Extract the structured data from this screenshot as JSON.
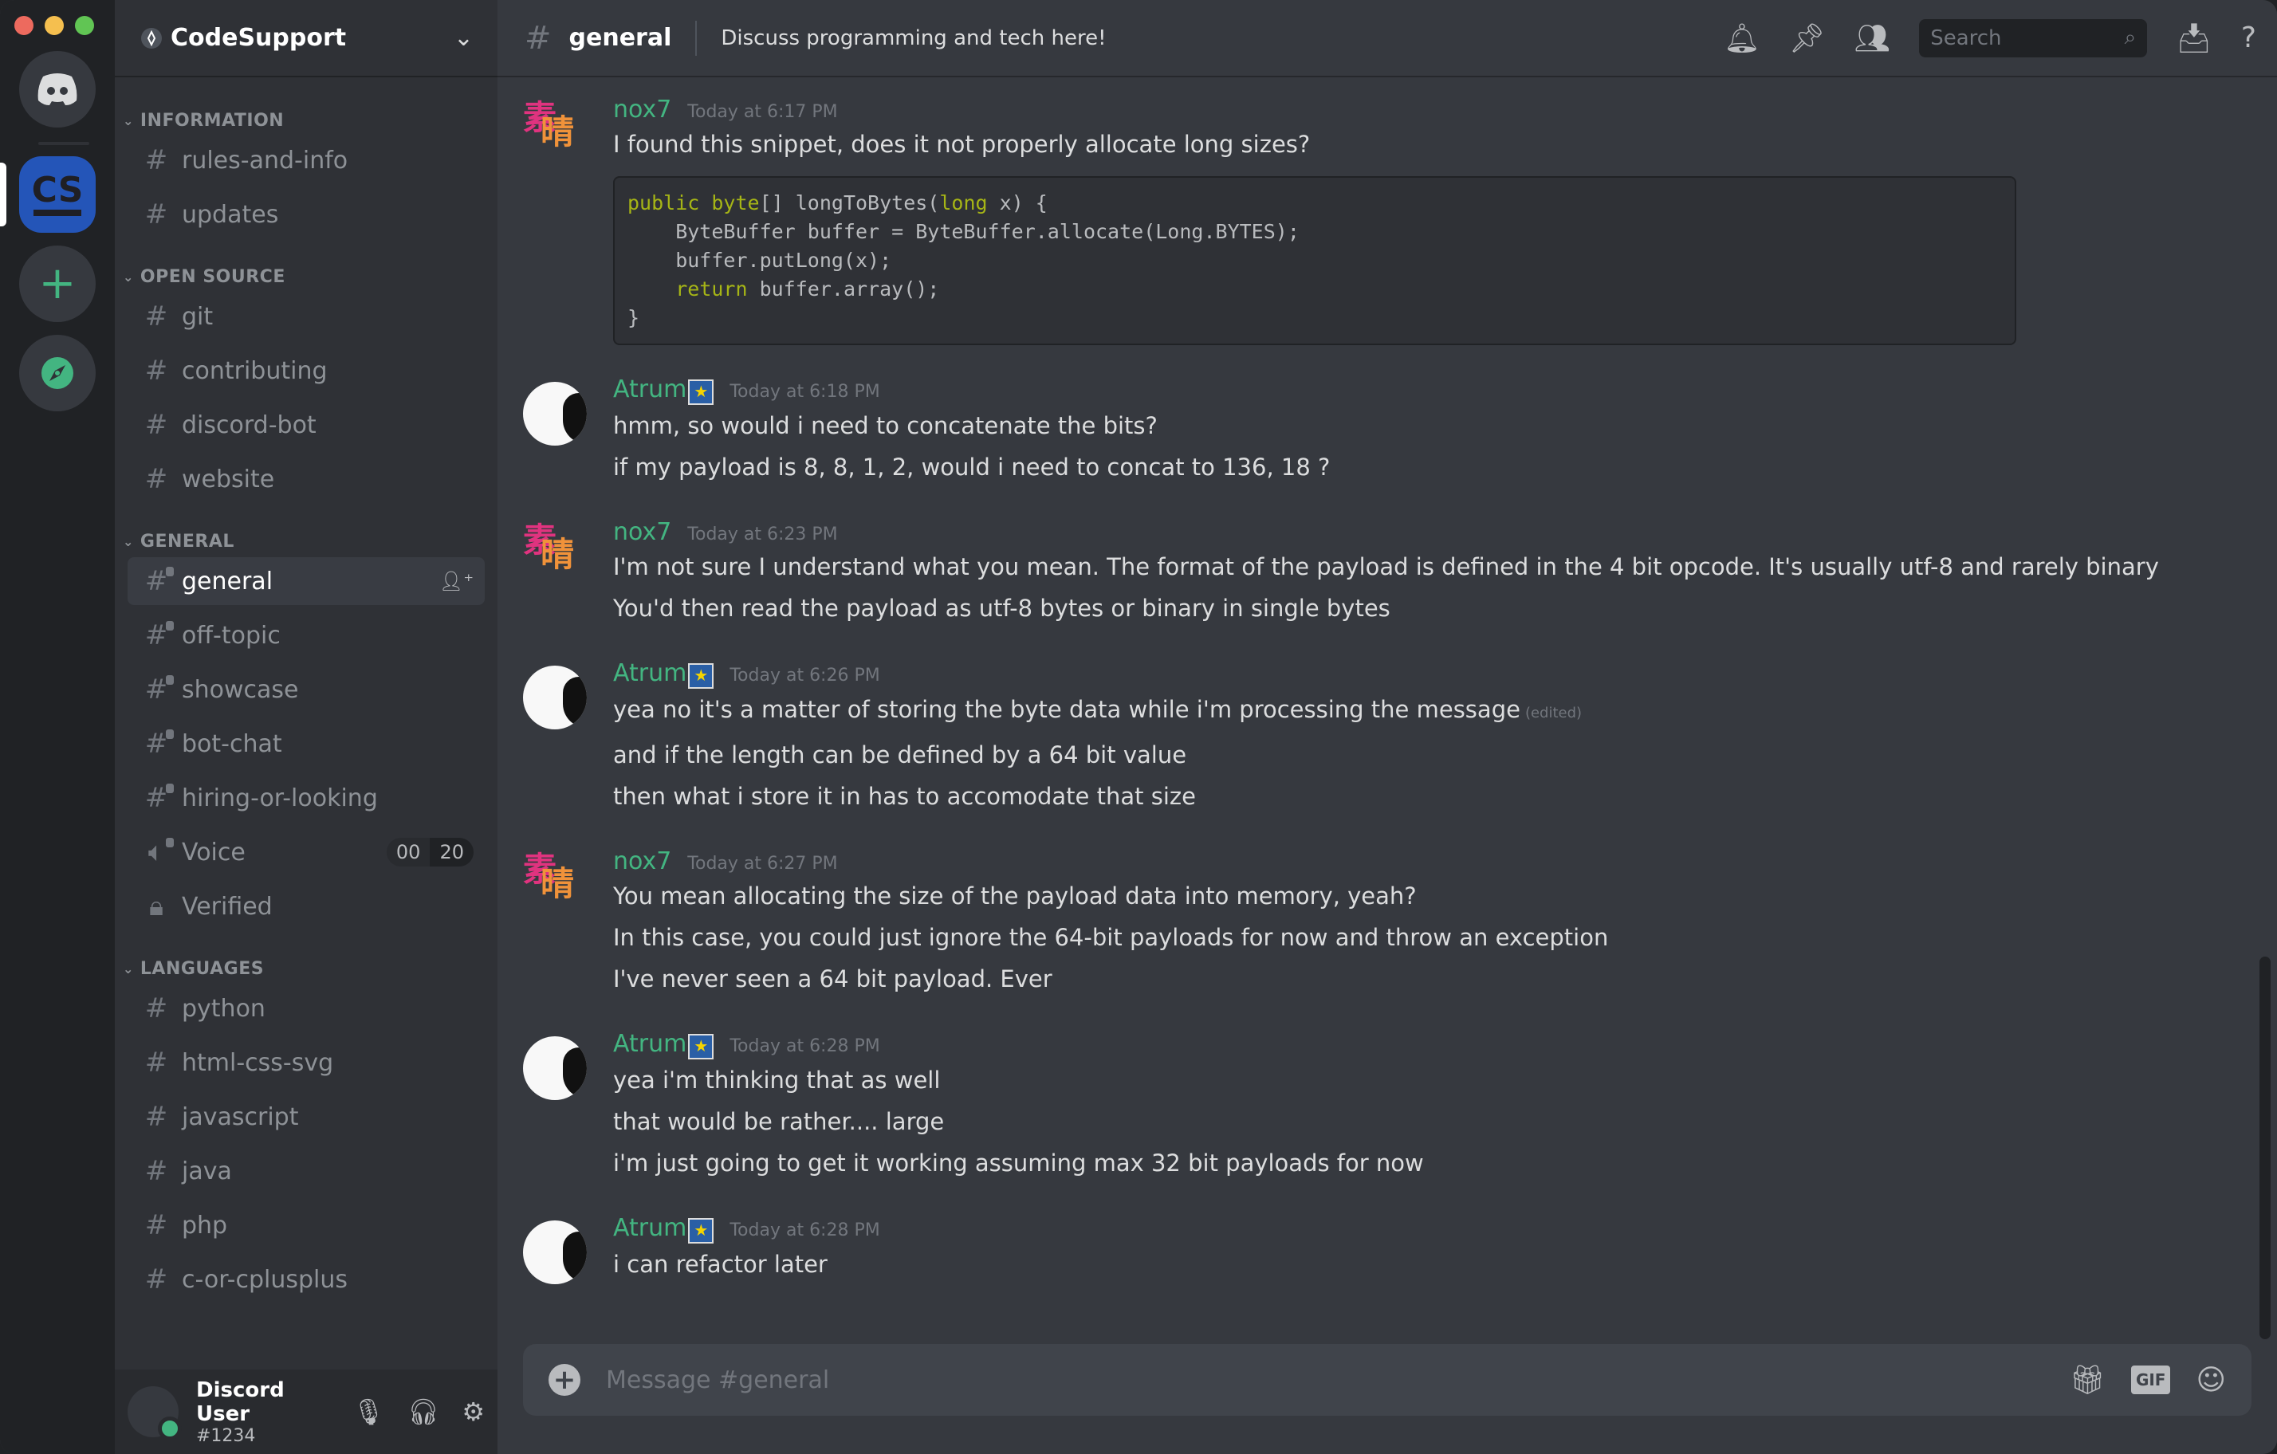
{
  "window": {
    "traffic_lights": [
      "#ed6a5e",
      "#f5bf4f",
      "#61c554"
    ]
  },
  "server_rail": {
    "servers": [
      {
        "name": "Discord Home",
        "icon": "discord-logo-icon"
      },
      {
        "name": "CodeSupport",
        "icon_text": "CS",
        "active": true
      },
      {
        "name": "Add a Server",
        "icon": "plus-icon"
      },
      {
        "name": "Explore Public Servers",
        "icon": "compass-icon"
      }
    ]
  },
  "sidebar": {
    "server_name": "CodeSupport",
    "categories": [
      {
        "name": "INFORMATION",
        "channels": [
          {
            "name": "rules-and-info",
            "type": "text"
          },
          {
            "name": "updates",
            "type": "text"
          }
        ]
      },
      {
        "name": "OPEN SOURCE",
        "channels": [
          {
            "name": "git",
            "type": "text"
          },
          {
            "name": "contributing",
            "type": "text"
          },
          {
            "name": "discord-bot",
            "type": "text"
          },
          {
            "name": "website",
            "type": "text"
          }
        ]
      },
      {
        "name": "GENERAL",
        "channels": [
          {
            "name": "general",
            "type": "text-locked",
            "active": true
          },
          {
            "name": "off-topic",
            "type": "text-locked"
          },
          {
            "name": "showcase",
            "type": "text-locked"
          },
          {
            "name": "bot-chat",
            "type": "text-locked"
          },
          {
            "name": "hiring-or-looking",
            "type": "text-locked"
          },
          {
            "name": "Voice",
            "type": "voice-locked",
            "users": "00",
            "limit": "20"
          },
          {
            "name": "Verified",
            "type": "locked"
          }
        ]
      },
      {
        "name": "LANGUAGES",
        "channels": [
          {
            "name": "python",
            "type": "text"
          },
          {
            "name": "html-css-svg",
            "type": "text"
          },
          {
            "name": "javascript",
            "type": "text"
          },
          {
            "name": "java",
            "type": "text"
          },
          {
            "name": "php",
            "type": "text"
          },
          {
            "name": "c-or-cplusplus",
            "type": "text"
          }
        ]
      }
    ],
    "user": {
      "name": "Discord User",
      "tag": "#1234",
      "status": "online"
    }
  },
  "header": {
    "channel": "general",
    "topic": "Discuss programming and tech here!",
    "search_placeholder": "Search"
  },
  "messages": [
    {
      "author": "nox7",
      "avatar": "nox7",
      "time": "Today at 6:17 PM",
      "lines": [
        "I found this snippet, does it not properly allocate long sizes?"
      ],
      "code": [
        [
          [
            "kw",
            "public"
          ],
          [
            "t",
            " "
          ],
          [
            "kw",
            "byte"
          ],
          [
            "t",
            "[] longToBytes("
          ],
          [
            "kw",
            "long"
          ],
          [
            "t",
            " x) {"
          ]
        ],
        [
          [
            "t",
            "    ByteBuffer buffer = ByteBuffer.allocate(Long.BYTES);"
          ]
        ],
        [
          [
            "t",
            "    buffer.putLong(x);"
          ]
        ],
        [
          [
            "t",
            "    "
          ],
          [
            "kw",
            "return"
          ],
          [
            "t",
            " buffer.array();"
          ]
        ],
        [
          [
            "t",
            "}"
          ]
        ]
      ]
    },
    {
      "author": "Atrum",
      "avatar": "atrum",
      "badge": true,
      "time": "Today at 6:18 PM",
      "lines": [
        "hmm, so would i need to concatenate the bits?",
        "if my payload is 8, 8, 1, 2, would i need to concat to 136, 18 ?"
      ]
    },
    {
      "author": "nox7",
      "avatar": "nox7",
      "time": "Today at 6:23 PM",
      "lines": [
        "I'm not sure I understand what you mean. The format of the payload is defined in the 4 bit opcode. It's usually utf-8 and rarely binary",
        "You'd then read the payload as utf-8 bytes or binary in single bytes"
      ]
    },
    {
      "author": "Atrum",
      "avatar": "atrum",
      "badge": true,
      "time": "Today at 6:26 PM",
      "lines": [
        "yea no it's a matter of storing the byte data while i'm processing the message",
        "and if the length can be defined by a 64 bit value",
        "then what i store it in has to accomodate that size"
      ],
      "edited_line": 0,
      "edited_label": "(edited)"
    },
    {
      "author": "nox7",
      "avatar": "nox7",
      "time": "Today at 6:27 PM",
      "lines": [
        "You mean allocating the size of the payload data into memory, yeah?",
        "In this case, you could just ignore the 64-bit payloads for now and throw an exception",
        "I've never seen a 64 bit payload. Ever"
      ]
    },
    {
      "author": "Atrum",
      "avatar": "atrum",
      "badge": true,
      "time": "Today at 6:28 PM",
      "lines": [
        "yea i'm thinking that as well",
        "that would be rather.... large",
        "i'm just going to get it working assuming max 32 bit payloads for now"
      ]
    },
    {
      "author": "Atrum",
      "avatar": "atrum",
      "badge": true,
      "time": "Today at 6:28 PM",
      "lines": [
        "i can refactor later"
      ]
    }
  ],
  "composer": {
    "placeholder": "Message #general",
    "gif_label": "GIF"
  },
  "colors": {
    "accent": "#43b581",
    "server_blue": "#2455b8",
    "code_keyword": "#a6b516"
  }
}
